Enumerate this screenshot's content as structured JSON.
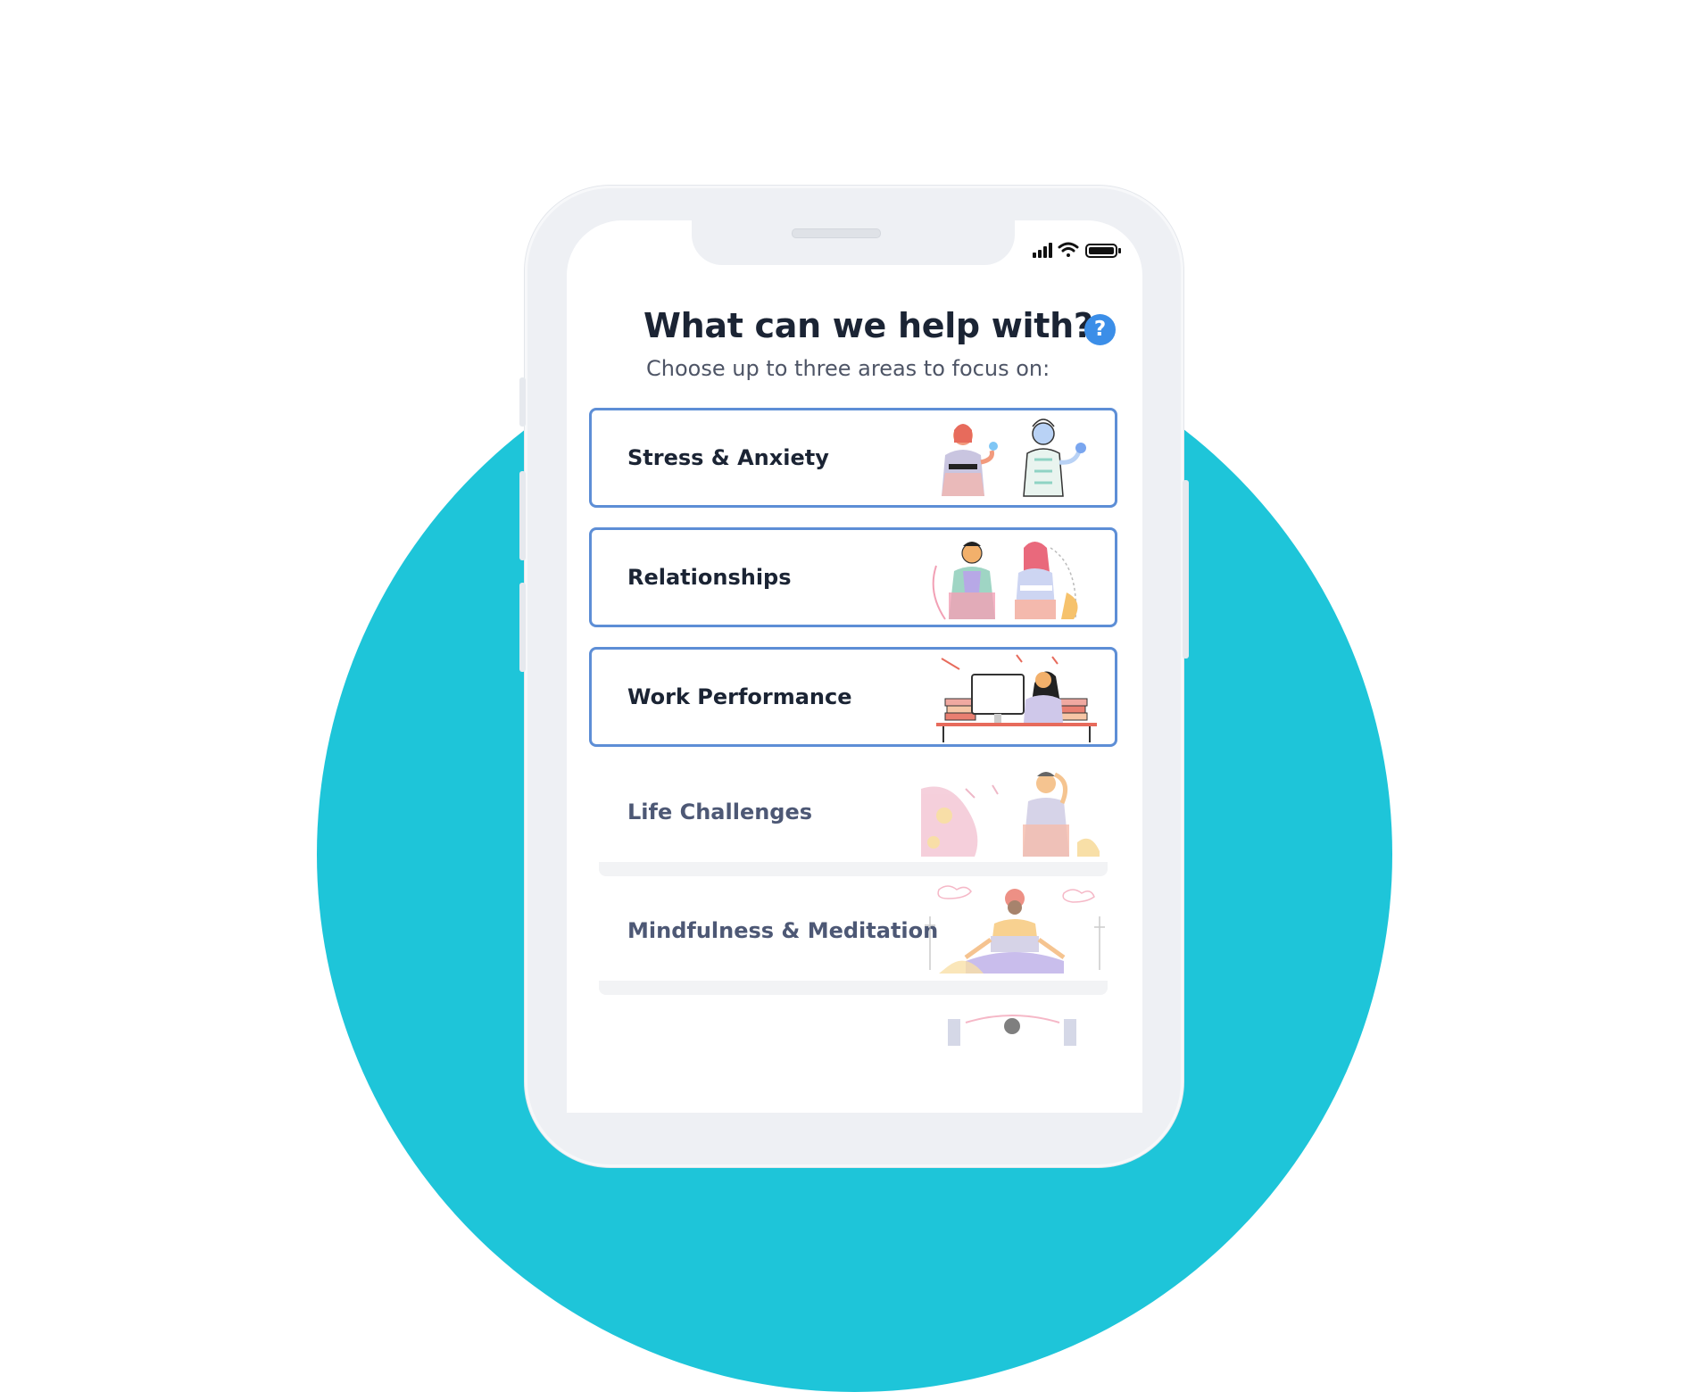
{
  "header": {
    "title": "What can we help with?",
    "subtitle": "Choose up to three areas to focus on:",
    "help_label": "?"
  },
  "topics": [
    {
      "label": "Stress & Anxiety",
      "selected": true,
      "illustration": "two-people-illustration"
    },
    {
      "label": "Relationships",
      "selected": true,
      "illustration": "couple-illustration"
    },
    {
      "label": "Work Performance",
      "selected": true,
      "illustration": "desk-work-illustration"
    },
    {
      "label": "Life Challenges",
      "selected": false,
      "illustration": "thinking-person-illustration"
    },
    {
      "label": "Mindfulness & Meditation",
      "selected": false,
      "illustration": "meditation-illustration"
    }
  ],
  "status_bar": {
    "icons": [
      "signal-icon",
      "wifi-icon",
      "battery-icon"
    ]
  },
  "colors": {
    "accent": "#1ec5d9",
    "selected_border": "#5d8ed6",
    "help": "#3b8ee8",
    "title": "#1b2434"
  }
}
